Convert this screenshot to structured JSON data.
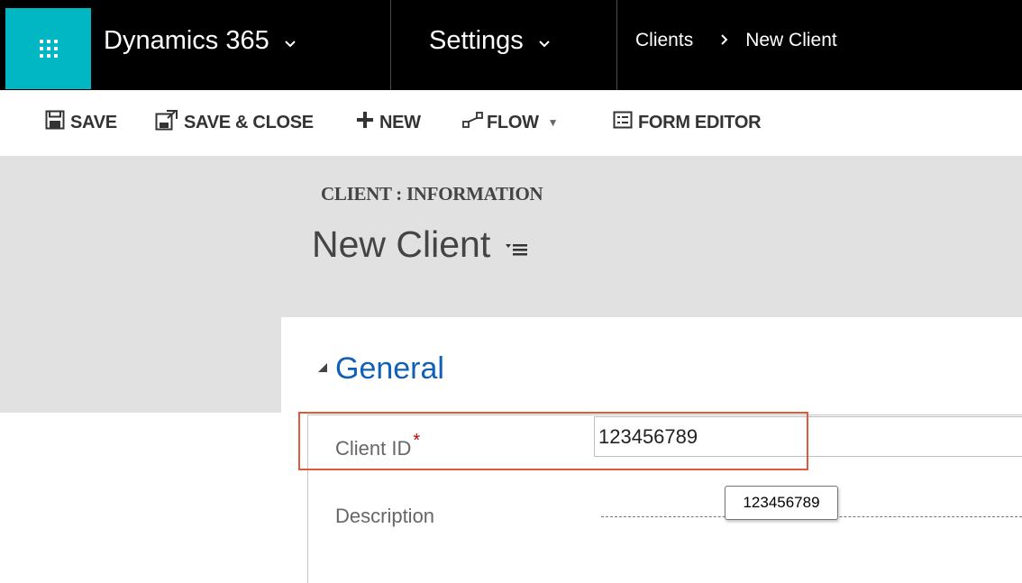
{
  "nav": {
    "app_title": "Dynamics 365",
    "area_title": "Settings",
    "breadcrumb": [
      "Clients",
      "New Client"
    ],
    "icons": {
      "launcher": "waffle-icon",
      "app_chevron": "chevron-down-icon",
      "area_chevron": "chevron-down-icon",
      "breadcrumb_separator": "chevron-right-icon"
    }
  },
  "toolbar": {
    "save_label": "SAVE",
    "save_close_label": "SAVE & CLOSE",
    "new_label": "NEW",
    "flow_label": "FLOW",
    "form_editor_label": "FORM EDITOR"
  },
  "header": {
    "entity_form": "CLIENT : INFORMATION",
    "record_title": "New Client"
  },
  "form": {
    "section_title": "General",
    "fields": [
      {
        "label": "Client ID",
        "required": true,
        "required_mark": "*",
        "value": "123456789"
      },
      {
        "label": "Description",
        "value": ""
      }
    ],
    "tooltip_text": "123456789"
  },
  "colors": {
    "launcher_bg": "#00b7c3",
    "nav_bg": "#000000",
    "header_bg": "#e1e1e1",
    "section_title": "#1160b7",
    "highlight_border": "#e05a3a",
    "required_mark": "#c80000"
  }
}
